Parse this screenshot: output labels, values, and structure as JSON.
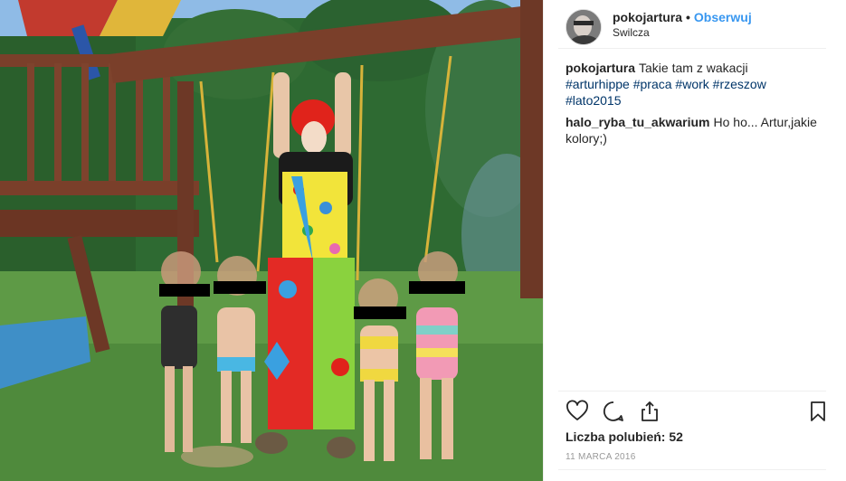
{
  "header": {
    "username": "pokojartura",
    "separator": "•",
    "follow_label": "Obserwuj",
    "location": "Swilcza"
  },
  "comments": [
    {
      "author": "pokojartura",
      "text": "Takie tam z wakacji",
      "hashtags": [
        "#arturhippe",
        "#praca",
        "#work",
        "#rzeszow",
        "#lato2015"
      ]
    },
    {
      "author": "halo_ryba_tu_akwarium",
      "text": "Ho ho... Artur,jakie kolory;)"
    }
  ],
  "actions": {
    "like_icon": "heart-icon",
    "comment_icon": "comment-icon",
    "share_icon": "share-icon",
    "save_icon": "bookmark-icon"
  },
  "likes": {
    "text": "Liczba polubień: 52"
  },
  "date": "11 MARCA 2016",
  "colors": {
    "link_blue": "#3897f0",
    "hashtag_blue": "#003569",
    "text": "#262626",
    "muted": "#999999",
    "divider": "#efefef"
  }
}
